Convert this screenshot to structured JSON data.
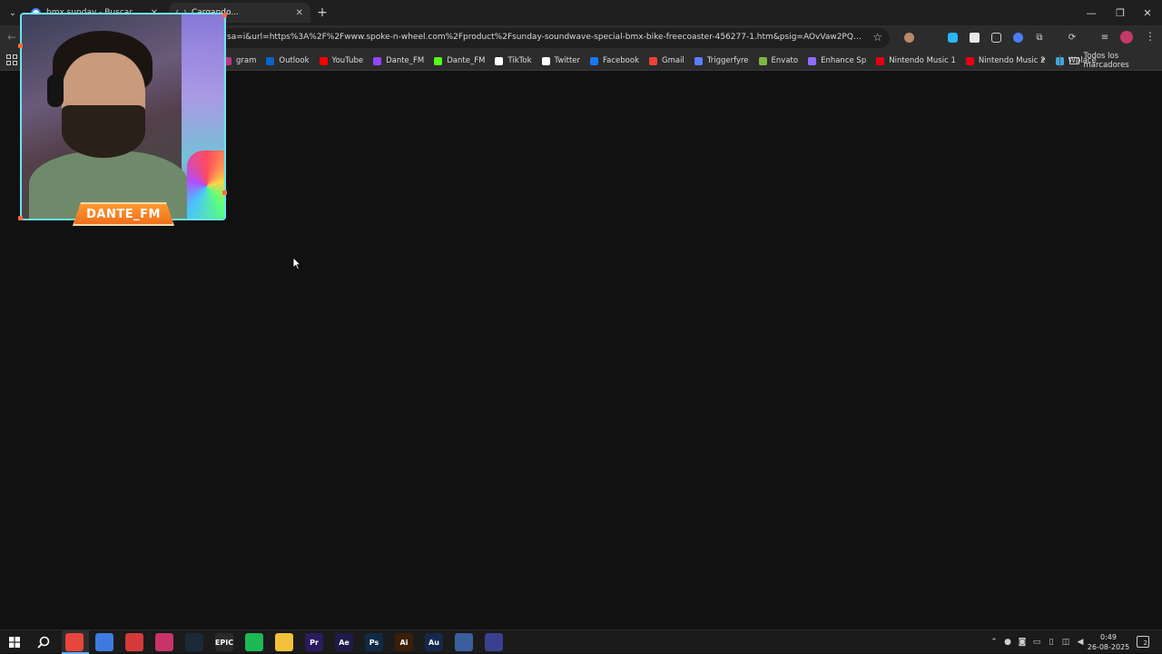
{
  "tabs": [
    {
      "title": "bmx sunday - Buscar con Goo...",
      "favicon_color": "#4285f4",
      "active": false
    },
    {
      "title": "Cargando...",
      "favicon_color": "#9aa0a6",
      "active": true
    }
  ],
  "toolbar": {
    "url": "sa=i&url=https%3A%2F%2Fwww.spoke-n-wheel.com%2Fproduct%2Fsunday-soundwave-special-bmx-bike-freecoaster-456277-1.htm&psig=AOvVaw2PQwmMF1ZG5yW..."
  },
  "bookmarks": [
    {
      "label": "gram",
      "color": "#c13584"
    },
    {
      "label": "Outlook",
      "color": "#0a64c8"
    },
    {
      "label": "YouTube",
      "color": "#ff0000"
    },
    {
      "label": "Dante_FM",
      "color": "#9146ff"
    },
    {
      "label": "Dante_FM",
      "color": "#53fc18"
    },
    {
      "label": "TikTok",
      "color": "#ffffff"
    },
    {
      "label": "Twitter",
      "color": "#ffffff"
    },
    {
      "label": "Facebook",
      "color": "#1877f2"
    },
    {
      "label": "Gmail",
      "color": "#ea4335"
    },
    {
      "label": "Triggerfyre",
      "color": "#5b7cff"
    },
    {
      "label": "Envato",
      "color": "#82b541"
    },
    {
      "label": "Enhance Sp",
      "color": "#8f6bff"
    },
    {
      "label": "Nintendo Music 1",
      "color": "#e60012"
    },
    {
      "label": "Nintendo Music 2",
      "color": "#e60012"
    },
    {
      "label": "Wplace",
      "color": "#3fa8e0"
    }
  ],
  "bookmarks_more": "»",
  "bookmarks_all": "Todos los marcadores",
  "webcam": {
    "name": "DANTE_FM"
  },
  "taskbar": {
    "apps": [
      {
        "name": "chrome",
        "text": "",
        "color": "#e8453c"
      },
      {
        "name": "chrome-alt",
        "text": "",
        "color": "#3d7be0"
      },
      {
        "name": "app-3",
        "text": "",
        "color": "#d43a3a"
      },
      {
        "name": "app-4",
        "text": "",
        "color": "#c8336a"
      },
      {
        "name": "steam",
        "text": "",
        "color": "#1b2838"
      },
      {
        "name": "epic",
        "text": "EPIC",
        "color": "#2a2a2a"
      },
      {
        "name": "spotify",
        "text": "",
        "color": "#1db954"
      },
      {
        "name": "explorer",
        "text": "",
        "color": "#f3c13a"
      },
      {
        "name": "premiere",
        "text": "Pr",
        "color": "#2a1a5e"
      },
      {
        "name": "after-effects",
        "text": "Ae",
        "color": "#1f1a4a"
      },
      {
        "name": "photoshop",
        "text": "Ps",
        "color": "#0f2a45"
      },
      {
        "name": "illustrator",
        "text": "Ai",
        "color": "#3a1e08"
      },
      {
        "name": "audition",
        "text": "Au",
        "color": "#14284a"
      },
      {
        "name": "calculator",
        "text": "",
        "color": "#3a5f9c"
      },
      {
        "name": "app-15",
        "text": "",
        "color": "#3b3f8f"
      }
    ],
    "clock_time": "0:49",
    "clock_date": "26-08-2025",
    "notifications": "2"
  }
}
